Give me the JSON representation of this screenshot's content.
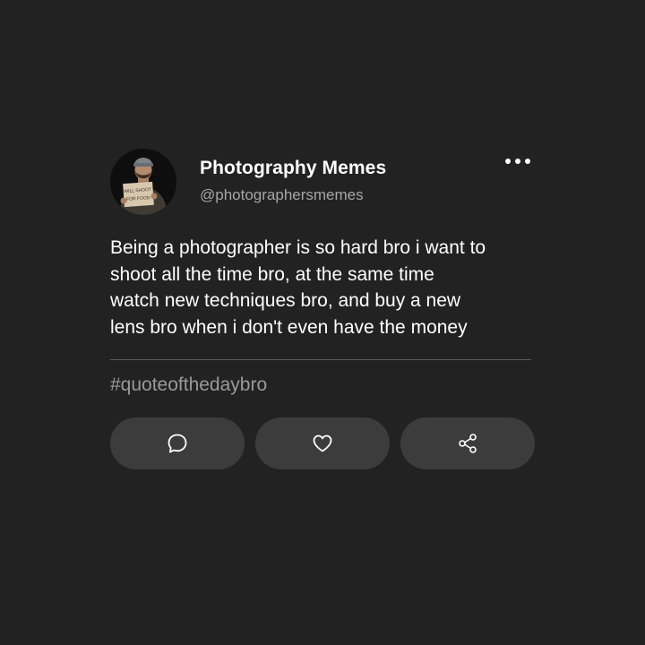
{
  "post": {
    "author_name": "Photography Memes",
    "author_handle": "@photographersmemes",
    "avatar_sign_text": "WILL SHOOT FOR FOOD",
    "text": "Being a photographer is so hard bro i want to\nshoot all the time bro, at the same time\nwatch new techniques bro, and buy a new\nlens bro when i don't even have the money",
    "hashtag": "#quoteofthedaybro"
  },
  "icons": {
    "more": "more-options-icon",
    "comment": "comment-icon",
    "like": "heart-icon",
    "share": "share-icon"
  },
  "colors": {
    "background": "#222222",
    "button": "#3c3c3c",
    "text": "#ffffff",
    "muted": "#a6a6a6"
  }
}
